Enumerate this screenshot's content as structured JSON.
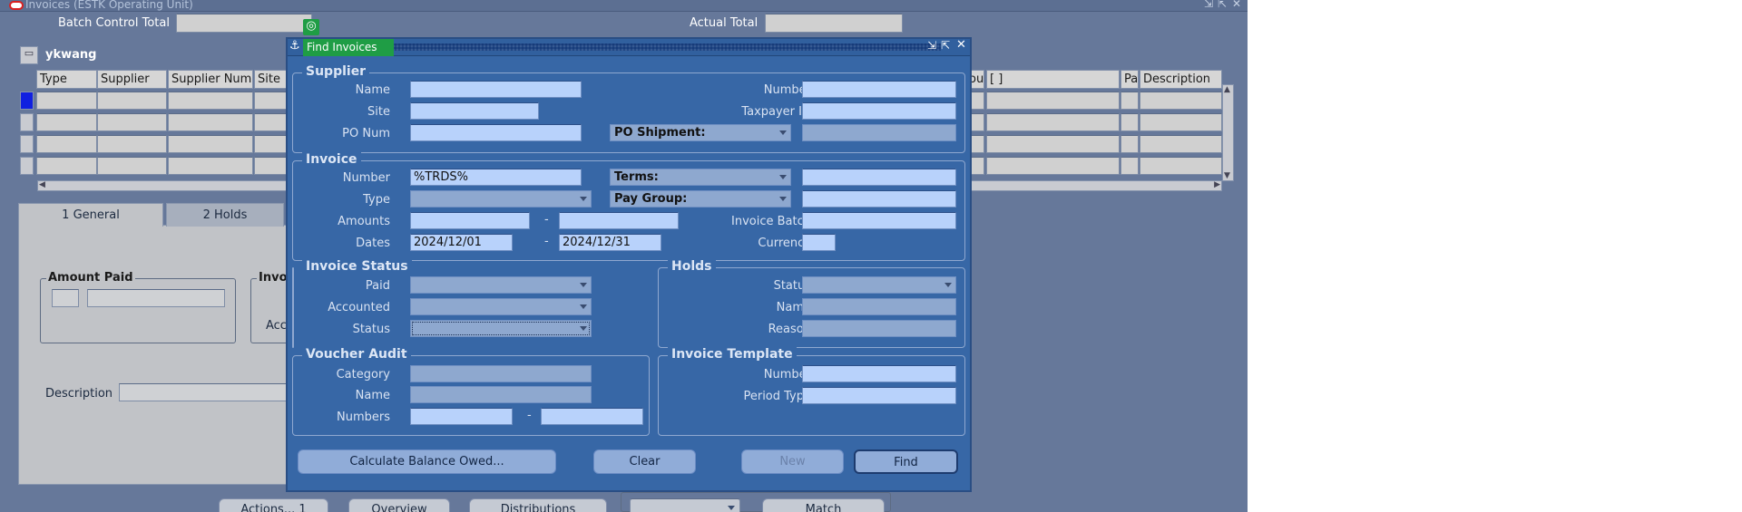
{
  "window": {
    "title": "Invoices (ESTK Operating Unit)",
    "controls": [
      "⇲",
      "⇱",
      "✕"
    ]
  },
  "main": {
    "batch_control_total_label": "Batch Control Total",
    "actual_total_label": "Actual Total",
    "user": "ykwang",
    "columns": [
      "Type",
      "Supplier",
      "Supplier Num",
      "Site",
      "[ ]",
      "Pa",
      "Description"
    ],
    "partial_column": "ou",
    "tabs": [
      "1 General",
      "2 Holds"
    ],
    "amount_paid_group": "Amount Paid",
    "invoice_group_partial": "Invo",
    "acc_partial": "Acc",
    "description_label": "Description",
    "bottom_buttons": [
      "Actions... 1",
      "Overview",
      "Distributions",
      "",
      "Match"
    ]
  },
  "dialog": {
    "title": "Find Invoices",
    "supplier": {
      "group": "Supplier",
      "name_label": "Name",
      "site_label": "Site",
      "po_num_label": "PO Num",
      "number_label": "Number",
      "taxpayer_label": "Taxpayer ID",
      "po_shipment": "PO Shipment:"
    },
    "invoice": {
      "group": "Invoice",
      "number_label": "Number",
      "number_value": "%TRDS%",
      "type_label": "Type",
      "amounts_label": "Amounts",
      "dates_label": "Dates",
      "date_from": "2024/12/01",
      "date_to": "2024/12/31",
      "terms": "Terms:",
      "pay_group": "Pay Group:",
      "invoice_batch_label": "Invoice Batch",
      "currency_label": "Currency",
      "dash": "-"
    },
    "invoice_status": {
      "group": "Invoice Status",
      "paid_label": "Paid",
      "accounted_label": "Accounted",
      "status_label": "Status"
    },
    "holds": {
      "group": "Holds",
      "status_label": "Status",
      "name_label": "Name",
      "reason_label": "Reason"
    },
    "voucher_audit": {
      "group": "Voucher Audit",
      "category_label": "Category",
      "name_label": "Name",
      "numbers_label": "Numbers"
    },
    "invoice_template": {
      "group": "Invoice Template",
      "number_label": "Number",
      "period_type_label": "Period Type"
    },
    "buttons": {
      "calculate": "Calculate Balance Owed...",
      "clear": "Clear",
      "new": "New",
      "find": "Find"
    }
  },
  "colors": {
    "dialog_bg": "#3767a6",
    "field_bg": "#b8d2fb",
    "window_bg": "#66789a"
  }
}
